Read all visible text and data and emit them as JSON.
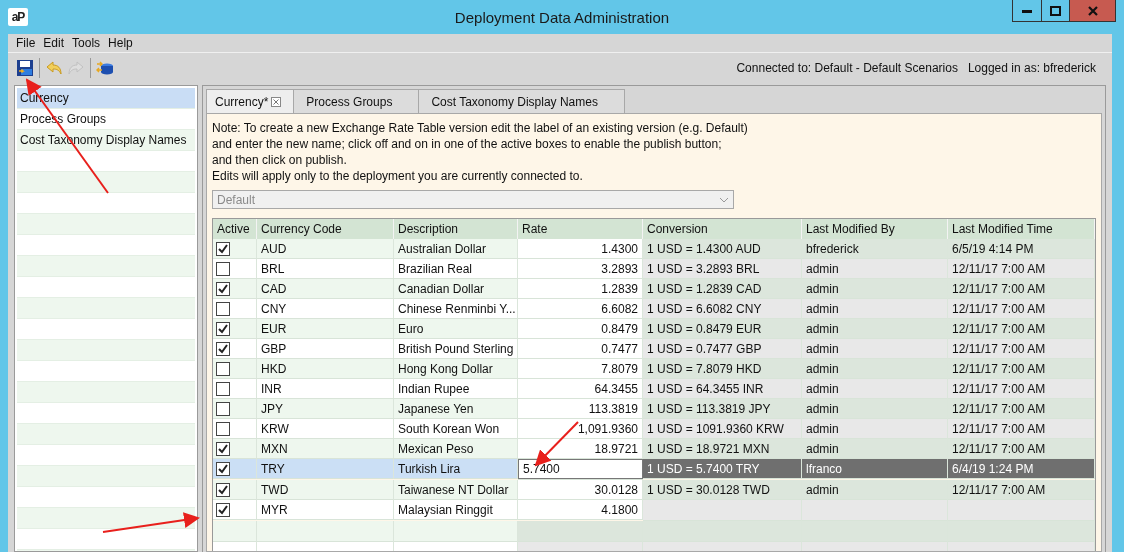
{
  "window": {
    "title": "Deployment Data Administration",
    "app_logo": "aP"
  },
  "menu": [
    "File",
    "Edit",
    "Tools",
    "Help"
  ],
  "toolbar": [
    {
      "kind": "save",
      "disabled": false
    },
    {
      "kind": "undo",
      "disabled": false
    },
    {
      "kind": "redo",
      "disabled": true
    },
    {
      "kind": "publish",
      "disabled": false
    }
  ],
  "connection": {
    "connected_to": "Connected to: Default - Default Scenarios",
    "logged_in_as": "Logged in as: bfrederick"
  },
  "sidebar": {
    "items": [
      {
        "label": "Currency",
        "selected": true
      },
      {
        "label": "Process Groups",
        "selected": false
      },
      {
        "label": "Cost Taxonomy Display Names",
        "selected": false
      }
    ]
  },
  "tabs": [
    {
      "label": "Currency*",
      "selected": true,
      "closable": true
    },
    {
      "label": "Process Groups",
      "selected": false,
      "closable": false
    },
    {
      "label": "Cost Taxonomy Display Names",
      "selected": false,
      "closable": false
    }
  ],
  "note": [
    "Note: To create a new Exchange Rate Table version edit the label of an existing version (e.g. Default)",
    "and enter the new name; click off and on in one of the active boxes to enable the publish button;",
    "and then click on publish.",
    "Edits will apply only to the deployment you are currently connected to."
  ],
  "version_select": {
    "value": "Default",
    "disabled": true
  },
  "table": {
    "columns": [
      "Active",
      "Currency Code",
      "Description",
      "Rate",
      "Conversion",
      "Last Modified By",
      "Last Modified Time"
    ],
    "rows": [
      {
        "active": true,
        "code": "AUD",
        "description": "Australian Dollar",
        "rate": "1.4300",
        "conversion": "1 USD = 1.4300 AUD",
        "modified_by": "bfrederick",
        "modified_time": "6/5/19 4:14 PM",
        "selected": false
      },
      {
        "active": false,
        "code": "BRL",
        "description": "Brazilian Real",
        "rate": "3.2893",
        "conversion": "1 USD = 3.2893 BRL",
        "modified_by": "admin",
        "modified_time": "12/11/17 7:00 AM",
        "selected": false
      },
      {
        "active": true,
        "code": "CAD",
        "description": "Canadian Dollar",
        "rate": "1.2839",
        "conversion": "1 USD = 1.2839 CAD",
        "modified_by": "admin",
        "modified_time": "12/11/17 7:00 AM",
        "selected": false
      },
      {
        "active": false,
        "code": "CNY",
        "description": "Chinese Renminbi Y...",
        "rate": "6.6082",
        "conversion": "1 USD = 6.6082 CNY",
        "modified_by": "admin",
        "modified_time": "12/11/17 7:00 AM",
        "selected": false
      },
      {
        "active": true,
        "code": "EUR",
        "description": "Euro",
        "rate": "0.8479",
        "conversion": "1 USD = 0.8479 EUR",
        "modified_by": "admin",
        "modified_time": "12/11/17 7:00 AM",
        "selected": false
      },
      {
        "active": true,
        "code": "GBP",
        "description": "British Pound Sterling",
        "rate": "0.7477",
        "conversion": "1 USD = 0.7477 GBP",
        "modified_by": "admin",
        "modified_time": "12/11/17 7:00 AM",
        "selected": false
      },
      {
        "active": false,
        "code": "HKD",
        "description": "Hong Kong Dollar",
        "rate": "7.8079",
        "conversion": "1 USD = 7.8079 HKD",
        "modified_by": "admin",
        "modified_time": "12/11/17 7:00 AM",
        "selected": false
      },
      {
        "active": false,
        "code": "INR",
        "description": "Indian Rupee",
        "rate": "64.3455",
        "conversion": "1 USD = 64.3455 INR",
        "modified_by": "admin",
        "modified_time": "12/11/17 7:00 AM",
        "selected": false
      },
      {
        "active": false,
        "code": "JPY",
        "description": "Japanese Yen",
        "rate": "113.3819",
        "conversion": "1 USD = 113.3819 JPY",
        "modified_by": "admin",
        "modified_time": "12/11/17 7:00 AM",
        "selected": false
      },
      {
        "active": false,
        "code": "KRW",
        "description": "South Korean Won",
        "rate": "1,091.9360",
        "conversion": "1 USD = 1091.9360 KRW",
        "modified_by": "admin",
        "modified_time": "12/11/17 7:00 AM",
        "selected": false
      },
      {
        "active": true,
        "code": "MXN",
        "description": "Mexican Peso",
        "rate": "18.9721",
        "conversion": "1 USD = 18.9721 MXN",
        "modified_by": "admin",
        "modified_time": "12/11/17 7:00 AM",
        "selected": false
      },
      {
        "active": true,
        "code": "TRY",
        "description": "Turkish Lira",
        "rate": "5.7400",
        "conversion": "1 USD = 5.7400 TRY",
        "modified_by": "lfranco",
        "modified_time": "6/4/19 1:24 PM",
        "selected": true
      },
      {
        "active": true,
        "code": "TWD",
        "description": "Taiwanese NT Dollar",
        "rate": "30.0128",
        "conversion": "1 USD = 30.0128 TWD",
        "modified_by": "admin",
        "modified_time": "12/11/17 7:00 AM",
        "selected": false
      },
      {
        "active": true,
        "code": "MYR",
        "description": "Malaysian Ringgit",
        "rate": "4.1800",
        "selected": false
      }
    ]
  }
}
